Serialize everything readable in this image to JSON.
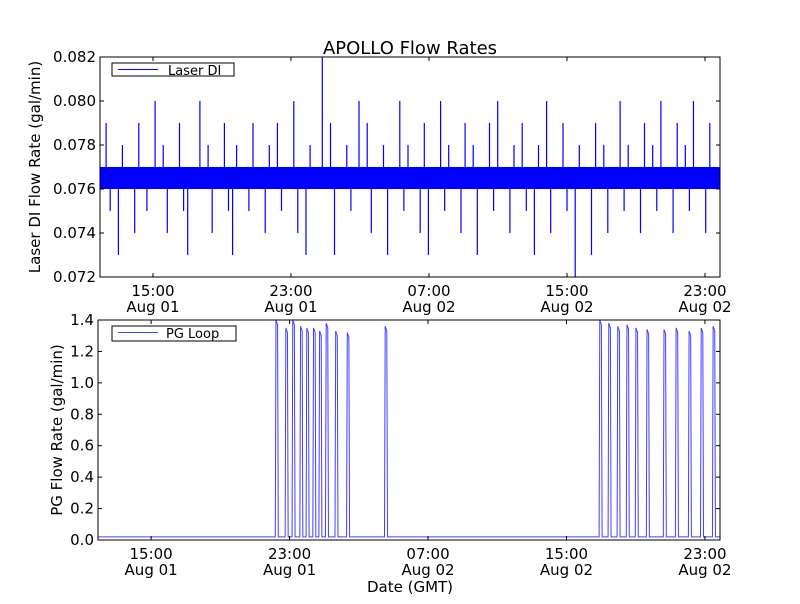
{
  "title": "APOLLO Flow Rates",
  "xlabel": "Date (GMT)",
  "chart_data": [
    {
      "type": "line",
      "name": "top",
      "ylabel": "Laser DI Flow Rate (gal/min)",
      "ylim": [
        0.072,
        0.082
      ],
      "yticks": [
        "0.072",
        "0.074",
        "0.076",
        "0.078",
        "0.080",
        "0.082"
      ],
      "xlim_hours": [
        11.93,
        47.87
      ],
      "xticks": [
        {
          "h": 15,
          "time": "15:00",
          "date": "Aug 01"
        },
        {
          "h": 23,
          "time": "23:00",
          "date": "Aug 01"
        },
        {
          "h": 31,
          "time": "07:00",
          "date": "Aug 02"
        },
        {
          "h": 39,
          "time": "15:00",
          "date": "Aug 02"
        },
        {
          "h": 47,
          "time": "23:00",
          "date": "Aug 02"
        }
      ],
      "legend": {
        "label": "Laser DI",
        "placement": "top-left"
      },
      "color": "#0000ff",
      "series_note_x": "hours since Aug 01 00:00 GMT",
      "values": [
        0.076,
        0.079,
        0.075,
        0.077,
        0.073,
        0.078,
        0.076,
        0.077,
        0.074,
        0.079,
        0.076,
        0.075,
        0.077,
        0.08,
        0.076,
        0.078,
        0.074,
        0.077,
        0.076,
        0.079,
        0.075,
        0.073,
        0.077,
        0.076,
        0.08,
        0.076,
        0.078,
        0.074,
        0.077,
        0.076,
        0.079,
        0.075,
        0.073,
        0.078,
        0.076,
        0.077,
        0.075,
        0.079,
        0.076,
        0.077,
        0.074,
        0.078,
        0.076,
        0.079,
        0.075,
        0.077,
        0.076,
        0.08,
        0.074,
        0.077,
        0.073,
        0.078,
        0.076,
        0.077,
        0.082,
        0.076,
        0.079,
        0.073,
        0.077,
        0.076,
        0.078,
        0.075,
        0.077,
        0.08,
        0.076,
        0.079,
        0.074,
        0.077,
        0.076,
        0.078,
        0.073,
        0.077,
        0.076,
        0.08,
        0.075,
        0.078,
        0.076,
        0.077,
        0.074,
        0.079,
        0.073,
        0.077,
        0.076,
        0.08,
        0.075,
        0.078,
        0.076,
        0.077,
        0.074,
        0.079,
        0.076,
        0.078,
        0.073,
        0.077,
        0.076,
        0.079,
        0.075,
        0.08,
        0.076,
        0.077,
        0.074,
        0.078,
        0.076,
        0.079,
        0.075,
        0.077,
        0.073,
        0.078,
        0.076,
        0.08,
        0.074,
        0.077,
        0.076,
        0.079,
        0.075,
        0.077,
        0.072,
        0.078,
        0.076,
        0.077,
        0.073,
        0.079,
        0.076,
        0.078,
        0.074,
        0.077,
        0.076,
        0.08,
        0.075,
        0.078,
        0.076,
        0.077,
        0.074,
        0.079,
        0.076,
        0.078,
        0.075,
        0.08,
        0.076,
        0.077,
        0.074,
        0.079,
        0.076,
        0.078,
        0.075,
        0.08,
        0.076,
        0.077,
        0.074,
        0.079,
        0.076,
        0.077
      ]
    },
    {
      "type": "line",
      "name": "bottom",
      "ylabel": "PG Flow Rate (gal/min)",
      "ylim": [
        0.0,
        1.4
      ],
      "yticks": [
        "0.0",
        "0.2",
        "0.4",
        "0.6",
        "0.8",
        "1.0",
        "1.2",
        "1.4"
      ],
      "xlim_hours": [
        11.93,
        47.87
      ],
      "xticks": [
        {
          "h": 15,
          "time": "15:00",
          "date": "Aug 01"
        },
        {
          "h": 23,
          "time": "23:00",
          "date": "Aug 01"
        },
        {
          "h": 31,
          "time": "07:00",
          "date": "Aug 02"
        },
        {
          "h": 39,
          "time": "15:00",
          "date": "Aug 02"
        },
        {
          "h": 47,
          "time": "23:00",
          "date": "Aug 02"
        }
      ],
      "legend": {
        "label": "PG Loop",
        "placement": "top-left"
      },
      "color": "#4040ff",
      "baseline": 0.02,
      "peaks": [
        {
          "h": 22.26,
          "v": 1.4
        },
        {
          "h": 22.83,
          "v": 1.35
        },
        {
          "h": 23.23,
          "v": 1.4
        },
        {
          "h": 23.68,
          "v": 1.36
        },
        {
          "h": 24.04,
          "v": 1.35
        },
        {
          "h": 24.43,
          "v": 1.35
        },
        {
          "h": 24.78,
          "v": 1.33
        },
        {
          "h": 25.16,
          "v": 1.38
        },
        {
          "h": 25.71,
          "v": 1.33
        },
        {
          "h": 26.38,
          "v": 1.32
        },
        {
          "h": 28.57,
          "v": 1.36
        },
        {
          "h": 40.97,
          "v": 1.4
        },
        {
          "h": 41.49,
          "v": 1.38
        },
        {
          "h": 42.01,
          "v": 1.36
        },
        {
          "h": 42.54,
          "v": 1.37
        },
        {
          "h": 43.06,
          "v": 1.35
        },
        {
          "h": 43.7,
          "v": 1.34
        },
        {
          "h": 44.68,
          "v": 1.34
        },
        {
          "h": 45.38,
          "v": 1.35
        },
        {
          "h": 46.13,
          "v": 1.33
        },
        {
          "h": 46.83,
          "v": 1.35
        },
        {
          "h": 47.52,
          "v": 1.36
        }
      ]
    }
  ]
}
